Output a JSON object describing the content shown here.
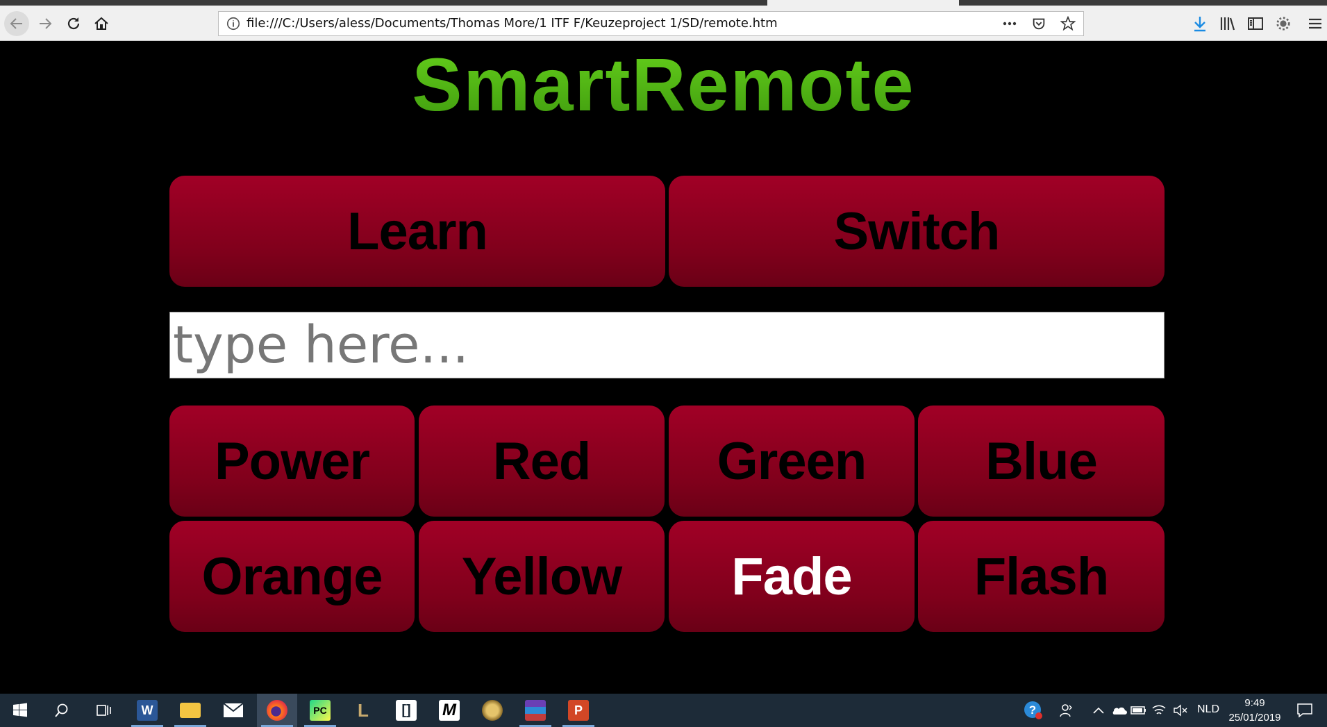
{
  "browser": {
    "url": "file:///C:/Users/aless/Documents/Thomas More/1 ITF F/Keuzeproject 1/SD/remote.htm",
    "icons": [
      "back-icon",
      "forward-icon",
      "reload-icon",
      "home-icon",
      "info-icon",
      "more-icon",
      "pocket-icon",
      "bookmark-star-icon",
      "download-icon",
      "library-icon",
      "sidebar-icon",
      "extension-gear-icon",
      "menu-icon"
    ]
  },
  "page": {
    "title": "SmartRemote",
    "top_buttons": [
      "Learn",
      "Switch"
    ],
    "input": {
      "placeholder": "type here...",
      "value": ""
    },
    "buttons": [
      "Power",
      "Red",
      "Green",
      "Blue",
      "Orange",
      "Yellow",
      "Fade",
      "Flash"
    ],
    "active_button": "Fade",
    "colors": {
      "title": "#55b81c",
      "button": "#8f0020",
      "background": "#000000"
    }
  },
  "taskbar": {
    "apps": [
      "Word",
      "File Explorer",
      "Mail",
      "Firefox",
      "PyCharm",
      "League of Legends",
      "App",
      "Medium",
      "Game",
      "WinRAR",
      "PowerPoint"
    ],
    "language": "NLD",
    "time": "9:49",
    "date": "25/01/2019"
  }
}
